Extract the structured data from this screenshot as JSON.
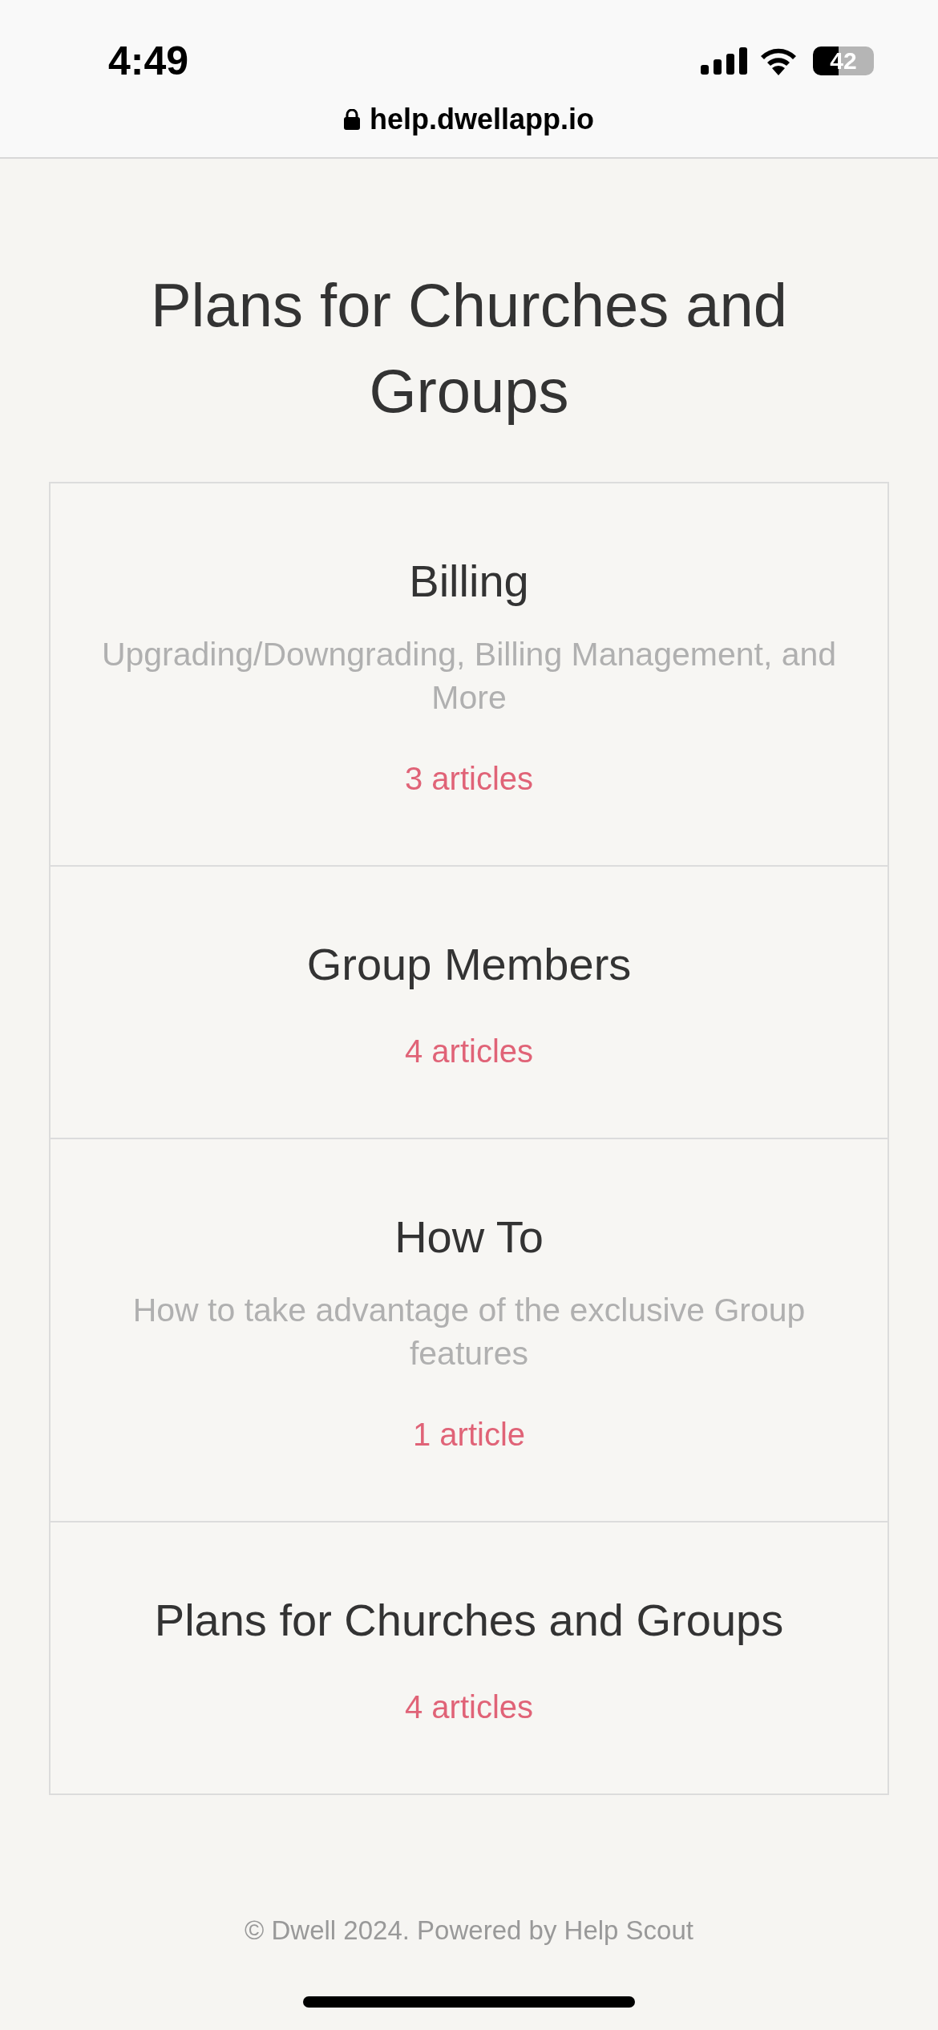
{
  "status_bar": {
    "time": "4:49",
    "battery": "42"
  },
  "address_bar": {
    "url": "help.dwellapp.io"
  },
  "title": "Plans for Churches and Groups",
  "categories": [
    {
      "name": "Billing",
      "description": "Upgrading/Downgrading, Billing Management, and More",
      "count": "3 articles"
    },
    {
      "name": "Group Members",
      "count": "4 articles"
    },
    {
      "name": "How To",
      "description": "How to take advantage of the exclusive Group features",
      "count": "1 article"
    },
    {
      "name": "Plans for Churches and Groups",
      "count": "4 articles"
    }
  ],
  "footer": "© Dwell 2024. Powered by Help Scout"
}
